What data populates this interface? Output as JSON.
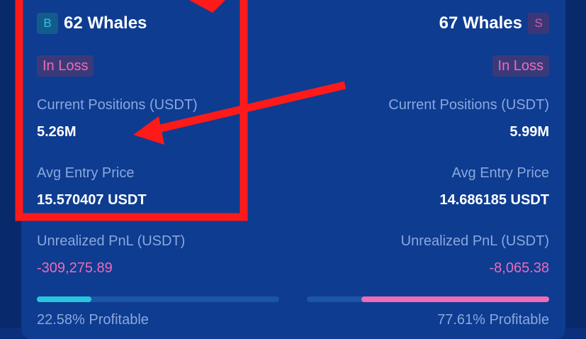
{
  "buy": {
    "badge": "B",
    "whales_label": "62 Whales",
    "status": "In Loss",
    "current_positions_label": "Current Positions (USDT)",
    "current_positions_value": "5.26M",
    "avg_entry_label": "Avg Entry Price",
    "avg_entry_value": "15.570407 USDT",
    "unrealized_pnl_label": "Unrealized PnL (USDT)",
    "unrealized_pnl_value": "-309,275.89",
    "profitable_label": "22.58% Profitable",
    "profitable_fraction": 0.2258
  },
  "sell": {
    "badge": "S",
    "whales_label": "67 Whales",
    "status": "In Loss",
    "current_positions_label": "Current Positions (USDT)",
    "current_positions_value": "5.99M",
    "avg_entry_label": "Avg Entry Price",
    "avg_entry_value": "14.686185 USDT",
    "unrealized_pnl_label": "Unrealized PnL (USDT)",
    "unrealized_pnl_value": "-8,065.38",
    "profitable_label": "77.61% Profitable",
    "profitable_fraction": 0.7761
  },
  "colors": {
    "page_background": "#0b2f7a",
    "card_background": "#0e3c91",
    "buy_accent": "#27c6dd",
    "sell_accent": "#f06ab4",
    "annotation_red": "#ff1a1a"
  }
}
